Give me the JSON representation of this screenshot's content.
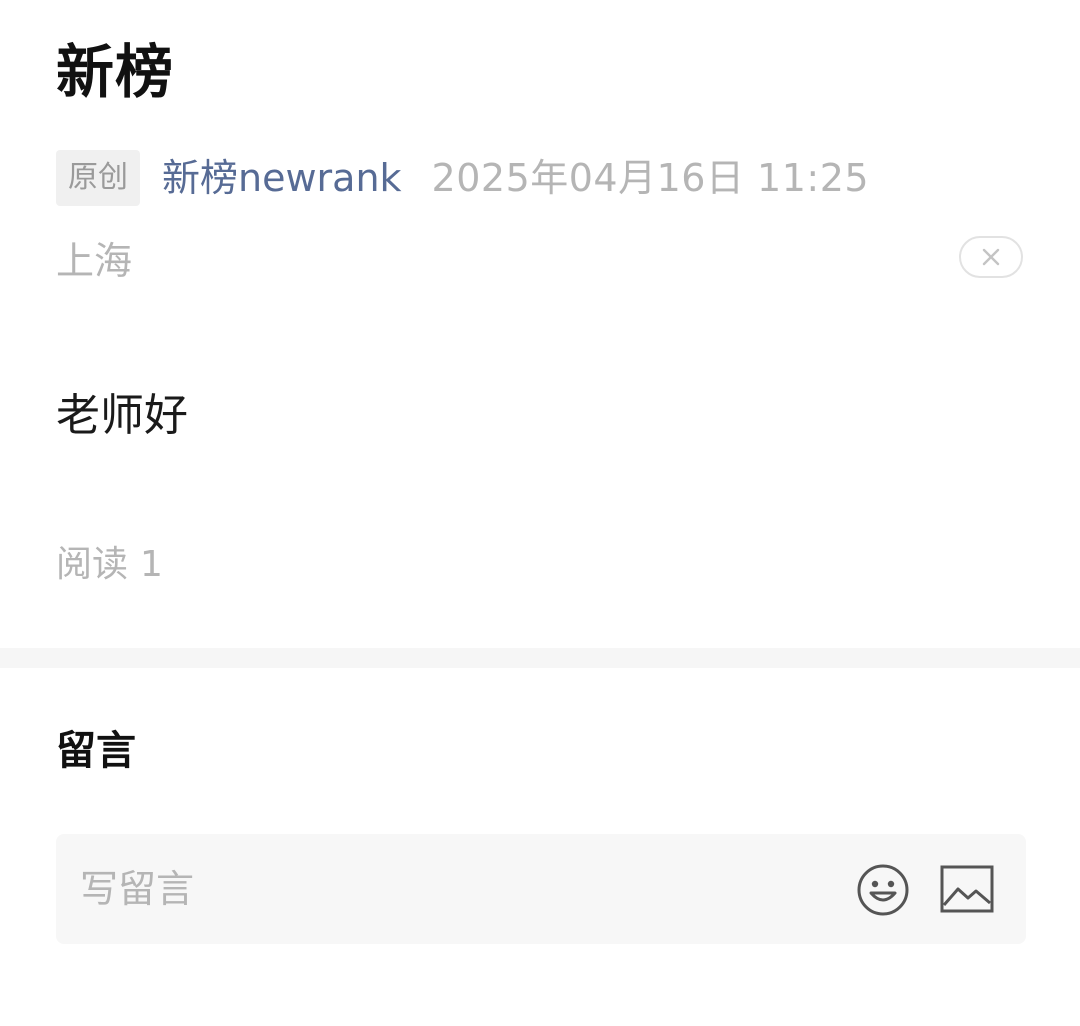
{
  "article": {
    "title": "新榜",
    "badge": "原创",
    "author": "新榜newrank",
    "datetime": "2025年04月16日 11:25",
    "location": "上海",
    "body": "老师好",
    "reads_label": "阅读",
    "reads_count": "1"
  },
  "comments": {
    "heading": "留言",
    "placeholder": "写留言"
  },
  "icons": {
    "close": "close-icon",
    "emoji": "emoji-icon",
    "image": "image-icon"
  },
  "colors": {
    "author_link": "#576b95",
    "muted_text": "#b5b5b5",
    "title_text": "#111111",
    "badge_bg": "#f0f0f0",
    "comment_box_bg": "#f7f7f7",
    "divider_bg": "#f6f6f6"
  }
}
